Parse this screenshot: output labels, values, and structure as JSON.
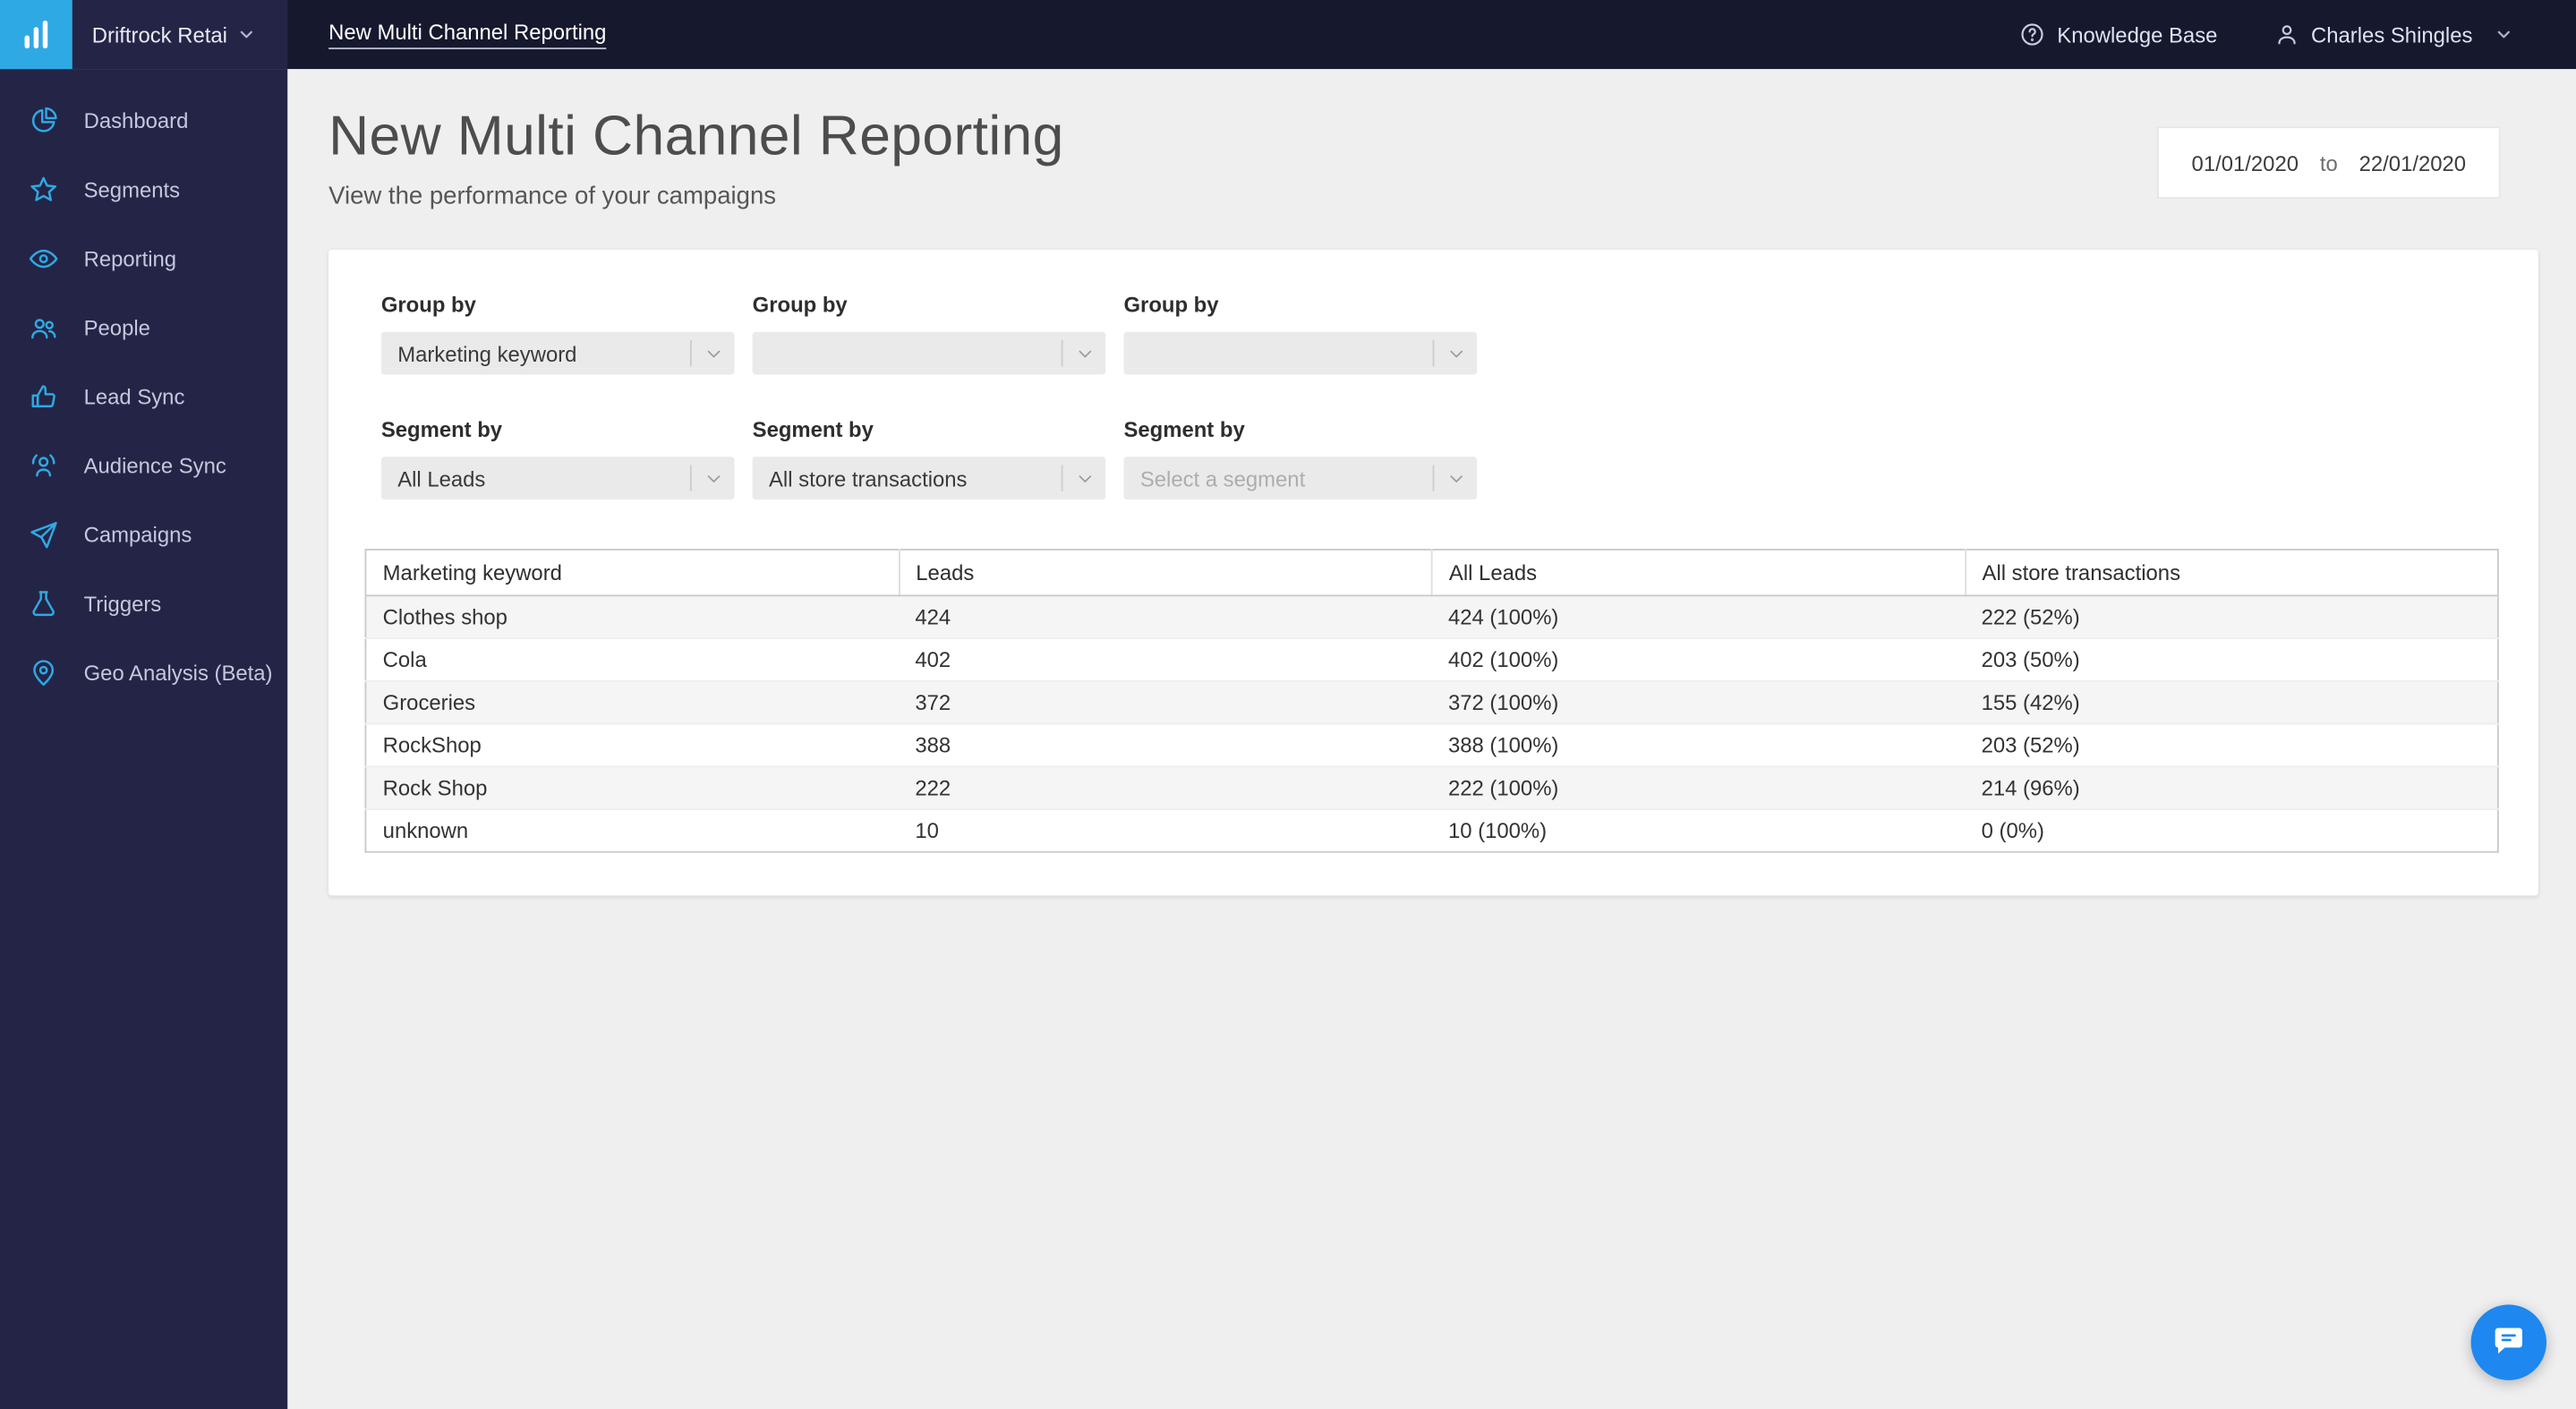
{
  "topbar": {
    "account_name": "Driftrock Retai",
    "page_title": "New Multi Channel Reporting",
    "knowledge_base": "Knowledge Base",
    "user_name": "Charles Shingles"
  },
  "sidebar": {
    "items": [
      {
        "label": "Dashboard",
        "icon": "pie-chart"
      },
      {
        "label": "Segments",
        "icon": "star"
      },
      {
        "label": "Reporting",
        "icon": "eye"
      },
      {
        "label": "People",
        "icon": "people"
      },
      {
        "label": "Lead Sync",
        "icon": "thumbs-up"
      },
      {
        "label": "Audience Sync",
        "icon": "person-sync"
      },
      {
        "label": "Campaigns",
        "icon": "paper-plane"
      },
      {
        "label": "Triggers",
        "icon": "flask"
      },
      {
        "label": "Geo Analysis (Beta)",
        "icon": "location-pin"
      }
    ]
  },
  "header": {
    "title": "New Multi Channel Reporting",
    "subtitle": "View the performance of your campaigns",
    "date_from": "01/01/2020",
    "date_separator": "to",
    "date_to": "22/01/2020"
  },
  "filters": {
    "group_by_label": "Group by",
    "segment_by_label": "Segment by",
    "group_by": [
      {
        "value": "Marketing keyword",
        "placeholder": false
      },
      {
        "value": "",
        "placeholder": false
      },
      {
        "value": "",
        "placeholder": false
      }
    ],
    "segment_by": [
      {
        "value": "All Leads",
        "placeholder": false
      },
      {
        "value": "All store transactions",
        "placeholder": false
      },
      {
        "value": "Select a segment",
        "placeholder": true
      }
    ]
  },
  "table": {
    "columns": [
      "Marketing keyword",
      "Leads",
      "All Leads",
      "All store transactions"
    ],
    "rows": [
      [
        "Clothes shop",
        "424",
        "424 (100%)",
        "222 (52%)"
      ],
      [
        "Cola",
        "402",
        "402 (100%)",
        "203 (50%)"
      ],
      [
        "Groceries",
        "372",
        "372 (100%)",
        "155 (42%)"
      ],
      [
        "RockShop",
        "388",
        "388 (100%)",
        "203 (52%)"
      ],
      [
        "Rock Shop",
        "222",
        "222 (100%)",
        "214 (96%)"
      ],
      [
        "unknown",
        "10",
        "10 (100%)",
        "0 (0%)"
      ]
    ]
  },
  "colors": {
    "accent_blue": "#2fa9e4",
    "topbar_bg": "#16182e",
    "sidebar_bg": "#242546",
    "intercom_blue": "#1e87f0"
  }
}
